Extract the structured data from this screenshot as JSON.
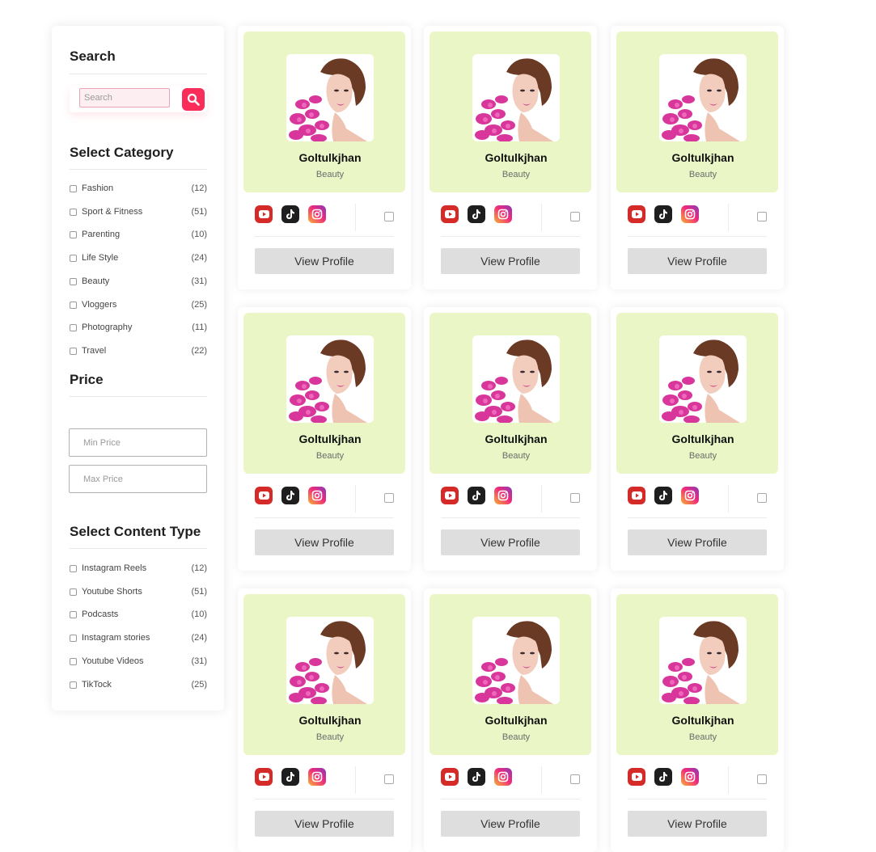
{
  "sidebar": {
    "search": {
      "title": "Search",
      "placeholder": "Search"
    },
    "category": {
      "title": "Select Category",
      "items": [
        {
          "label": "Fashion",
          "count": "(12)"
        },
        {
          "label": "Sport & Fitness",
          "count": "(51)"
        },
        {
          "label": "Parenting",
          "count": "(10)"
        },
        {
          "label": "Life Style",
          "count": "(24)"
        },
        {
          "label": "Beauty",
          "count": "(31)"
        },
        {
          "label": "Vloggers",
          "count": "(25)"
        },
        {
          "label": "Photography",
          "count": "(11)"
        },
        {
          "label": "Travel",
          "count": "(22)"
        }
      ]
    },
    "price": {
      "title": "Price",
      "min_placeholder": "Min Price",
      "max_placeholder": "Max Price"
    },
    "content_type": {
      "title": "Select Content Type",
      "items": [
        {
          "label": "Instagram Reels",
          "count": "(12)"
        },
        {
          "label": "Youtube Shorts",
          "count": "(51)"
        },
        {
          "label": "Podcasts",
          "count": "(10)"
        },
        {
          "label": "Instagram stories",
          "count": "(24)"
        },
        {
          "label": "Youtube Videos",
          "count": "(31)"
        },
        {
          "label": "TikTock",
          "count": "(25)"
        }
      ]
    }
  },
  "cards": [
    {
      "name": "Goltulkjhan",
      "category": "Beauty",
      "button": "View Profile"
    },
    {
      "name": "Goltulkjhan",
      "category": "Beauty",
      "button": "View Profile"
    },
    {
      "name": "Goltulkjhan",
      "category": "Beauty",
      "button": "View Profile"
    },
    {
      "name": "Goltulkjhan",
      "category": "Beauty",
      "button": "View Profile"
    },
    {
      "name": "Goltulkjhan",
      "category": "Beauty",
      "button": "View Profile"
    },
    {
      "name": "Goltulkjhan",
      "category": "Beauty",
      "button": "View Profile"
    },
    {
      "name": "Goltulkjhan",
      "category": "Beauty",
      "button": "View Profile"
    },
    {
      "name": "Goltulkjhan",
      "category": "Beauty",
      "button": "View Profile"
    },
    {
      "name": "Goltulkjhan",
      "category": "Beauty",
      "button": "View Profile"
    }
  ],
  "social_icons": [
    "youtube-icon",
    "tiktok-icon",
    "instagram-icon"
  ],
  "colors": {
    "accent": "#fa2d5a",
    "card_top": "#eaf6c5",
    "youtube": "#d42a28",
    "tiktok": "#1e1e1e",
    "button_bg": "#dedede"
  }
}
